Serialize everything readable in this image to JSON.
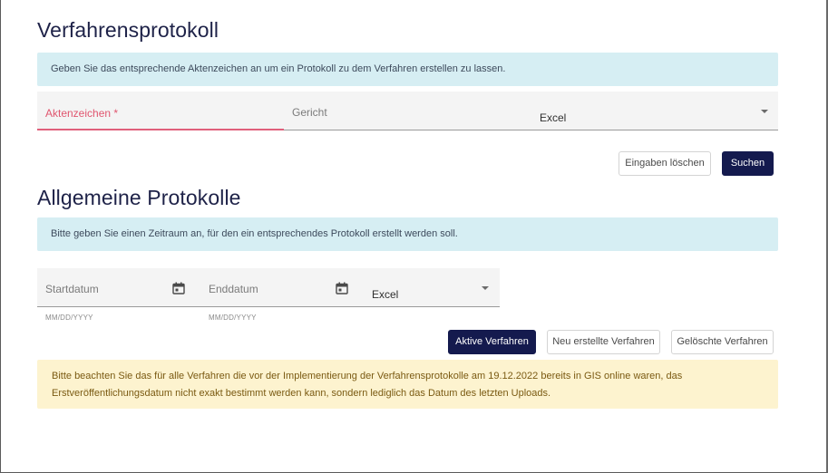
{
  "case_protocol": {
    "title": "Verfahrensprotokoll",
    "info": "Geben Sie das entsprechende Aktenzeichen an um ein Protokoll zu dem Verfahren erstellen zu lassen.",
    "aktenzeichen_label": "Aktenzeichen *",
    "gericht_label": "Gericht",
    "format_value": "Excel",
    "clear_button": "Eingaben löschen",
    "search_button": "Suchen"
  },
  "general_protocols": {
    "title": "Allgemeine Protokolle",
    "info": "Bitte geben Sie einen Zeitraum an, für den ein entsprechendes Protokoll erstellt werden soll.",
    "start_label": "Startdatum",
    "end_label": "Enddatum",
    "start_hint": "MM/DD/YYYY",
    "end_hint": "MM/DD/YYYY",
    "format_value": "Excel",
    "active_button": "Aktive Verfahren",
    "new_button": "Neu erstellte Verfahren",
    "deleted_button": "Gelöschte Verfahren",
    "warning_line1": "Bitte beachten Sie das für alle Verfahren die vor der Implementierung der Verfahrensprotokolle am 19.12.2022 bereits in GIS online waren, das",
    "warning_line2": "Erstveröffentlichungsdatum nicht exakt bestimmt werden kann, sondern lediglich das Datum des letzten Uploads."
  },
  "colors": {
    "primary": "#141a4e",
    "info_bg": "#d6eef3",
    "warning_bg": "#fdf3cf",
    "required_accent": "#e0566f"
  },
  "icons": {
    "calendar": "calendar-icon",
    "dropdown": "chevron-down-icon"
  }
}
